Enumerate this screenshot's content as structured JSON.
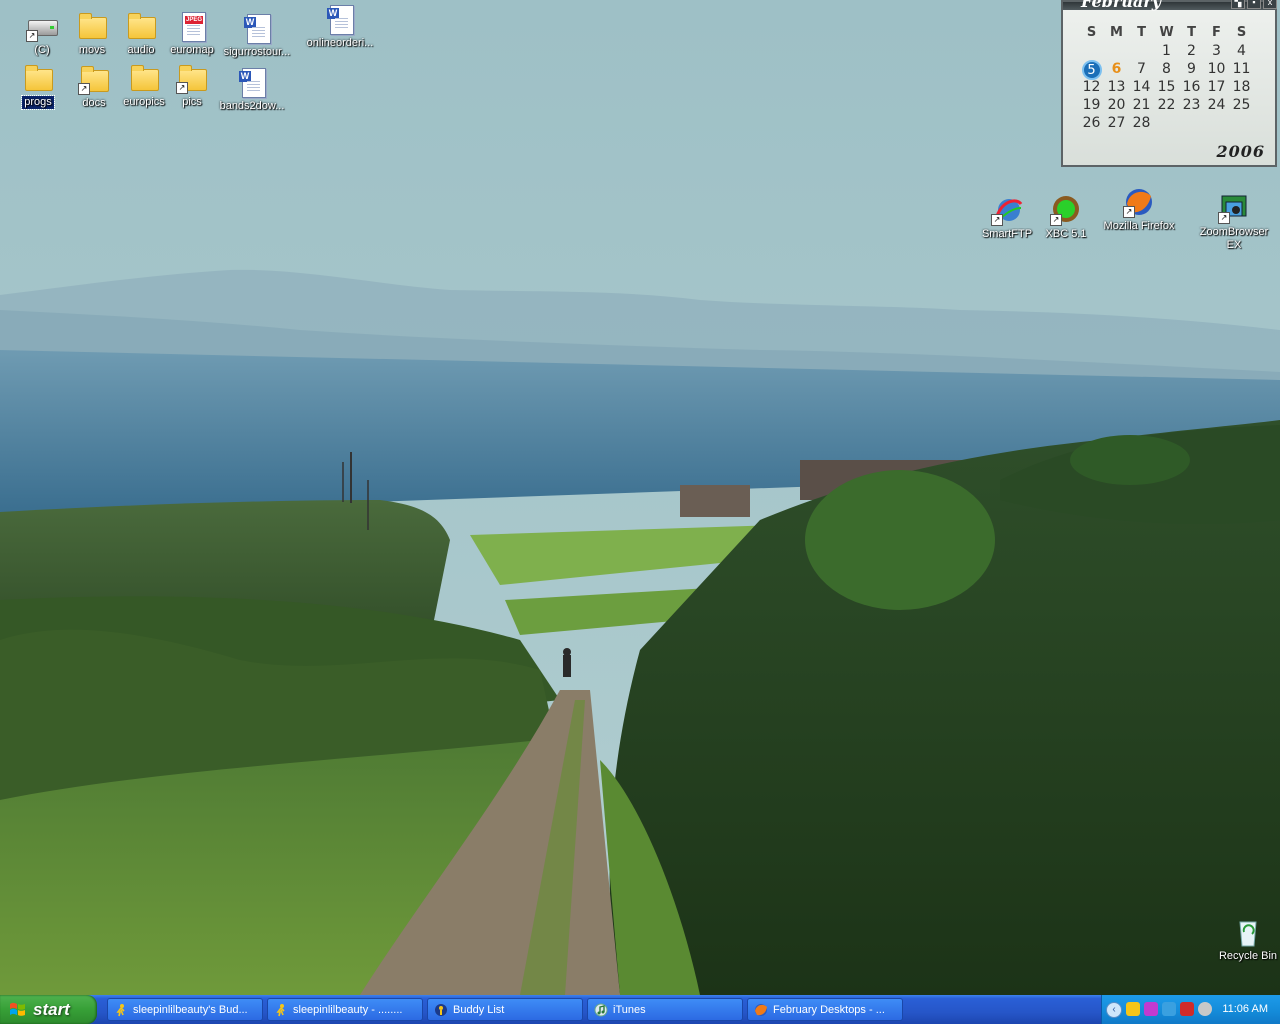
{
  "desktop_icons": {
    "drive_c": "(C)",
    "movs": "movs",
    "audio": "audio",
    "euromap": "euromap",
    "sigurros": "sigurrostour...",
    "onlineorder": "onlineorderi...",
    "progs": "progs",
    "docs": "docs",
    "europics": "europics",
    "pics": "pics",
    "bands": "bands2dow...",
    "smartftp": "SmartFTP",
    "xbc": "XBC 5.1",
    "firefox": "Mozilla Firefox",
    "zoombrowser": "ZoomBrowser EX",
    "recycle": "Recycle Bin",
    "jpeg_badge": "JPEG"
  },
  "calendar": {
    "month": "February",
    "year": "2006",
    "weekdays": [
      "S",
      "M",
      "T",
      "W",
      "T",
      "F",
      "S"
    ],
    "weeks": [
      [
        "",
        "",
        "",
        "1",
        "2",
        "3",
        "4"
      ],
      [
        "5",
        "6",
        "7",
        "8",
        "9",
        "10",
        "11"
      ],
      [
        "12",
        "13",
        "14",
        "15",
        "16",
        "17",
        "18"
      ],
      [
        "19",
        "20",
        "21",
        "22",
        "23",
        "24",
        "25"
      ],
      [
        "26",
        "27",
        "28",
        "",
        "",
        "",
        ""
      ]
    ],
    "today": "5",
    "highlight": "6",
    "today_color": "#1b6fb8",
    "highlight_color": "#e8901a"
  },
  "taskbar": {
    "start_label": "start",
    "tasks": [
      {
        "label": "sleepinlilbeauty's Bud...",
        "icon": "aim-runner-icon"
      },
      {
        "label": "sleepinlilbeauty - ........",
        "icon": "aim-runner-icon"
      },
      {
        "label": "Buddy List",
        "icon": "buddy-list-icon"
      },
      {
        "label": "iTunes",
        "icon": "itunes-icon"
      },
      {
        "label": "February Desktops - ...",
        "icon": "firefox-icon"
      }
    ],
    "clock": "11:06 AM"
  }
}
